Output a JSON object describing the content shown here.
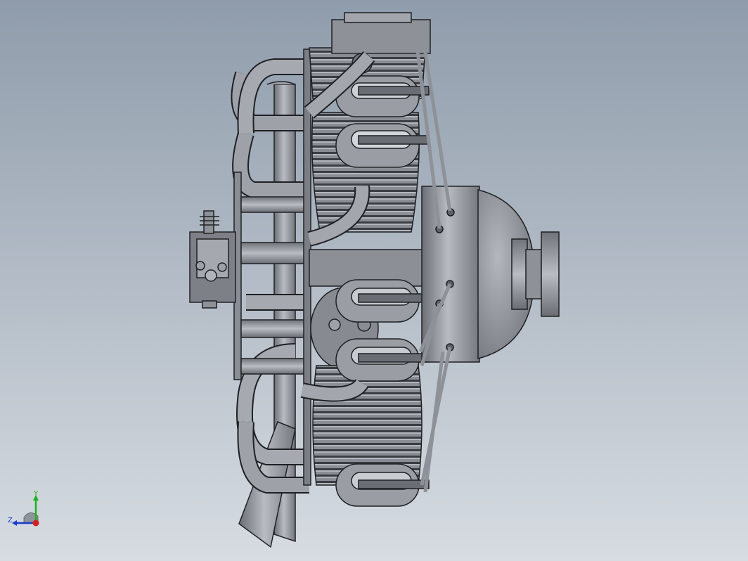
{
  "viewport": {
    "colors": {
      "bg_top": "#8f9cab",
      "bg_bottom": "#d7dce2",
      "metal": "#8e9299",
      "metal_light": "#c2c6cc",
      "metal_dark": "#55595f",
      "edge": "#1e2023"
    }
  },
  "model": {
    "subject": "radial-engine",
    "view": "side"
  },
  "triad": {
    "y_label": "Y",
    "z_label": "Z",
    "colors": {
      "y": "#1bb31b",
      "z": "#1a3cc9",
      "x": "#d42020"
    }
  }
}
